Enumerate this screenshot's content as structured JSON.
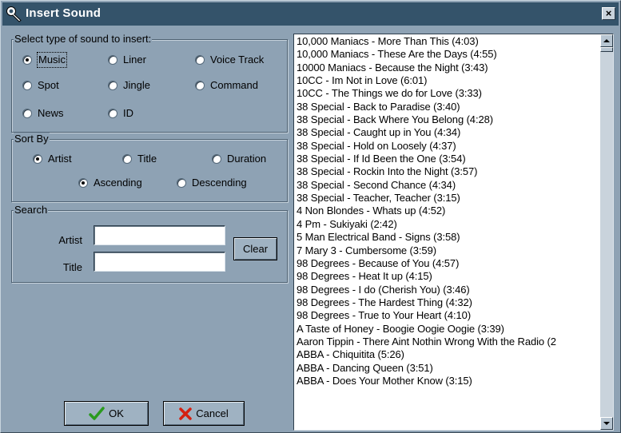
{
  "window": {
    "title": "Insert Sound",
    "close_glyph": "×"
  },
  "sound_type": {
    "label": "Select type of sound to insert:",
    "options": [
      "Music",
      "Liner",
      "Voice Track",
      "Spot",
      "Jingle",
      "Command",
      "News",
      "ID"
    ],
    "selected": "Music"
  },
  "sort": {
    "label": "Sort By",
    "fields": [
      "Artist",
      "Title",
      "Duration"
    ],
    "selected_field": "Artist",
    "orders": [
      "Ascending",
      "Descending"
    ],
    "selected_order": "Ascending"
  },
  "search": {
    "label": "Search",
    "artist_label": "Artist",
    "artist_value": "",
    "title_label": "Title",
    "title_value": "",
    "clear_label": "Clear"
  },
  "buttons": {
    "ok_label": "OK",
    "cancel_label": "Cancel"
  },
  "icons": {
    "ok": "check-icon",
    "cancel": "x-icon",
    "title": "wrench-icon"
  },
  "colors": {
    "titlebar": "#34536a",
    "background": "#8ea2b4",
    "ok_icon": "#2a9a1e",
    "cancel_icon": "#d42010"
  },
  "songs": [
    "10,000 Maniacs - More Than This (4:03)",
    "10,000 Maniacs - These Are the Days (4:55)",
    "10000 Maniacs - Because the Night (3:43)",
    "10CC - Im Not in Love (6:01)",
    "10CC - The Things we do for Love (3:33)",
    "38 Special - Back to Paradise (3:40)",
    "38 Special - Back Where You Belong (4:28)",
    "38 Special - Caught up in You (4:34)",
    "38 Special - Hold on Loosely (4:37)",
    "38 Special - If Id Been the One (3:54)",
    "38 Special - Rockin Into the Night (3:57)",
    "38 Special - Second Chance (4:34)",
    "38 Special - Teacher, Teacher (3:15)",
    "4 Non Blondes - Whats up (4:52)",
    "4 Pm - Sukiyaki (2:42)",
    "5 Man Electrical Band - Signs (3:58)",
    "7 Mary 3 - Cumbersome (3:59)",
    "98 Degrees - Because of You (4:57)",
    "98 Degrees - Heat It up (4:15)",
    "98 Degrees - I do (Cherish You) (3:46)",
    "98 Degrees - The Hardest Thing (4:32)",
    "98 Degrees - True to Your Heart (4:10)",
    "A Taste of Honey - Boogie Oogie Oogie (3:39)",
    "Aaron Tippin - There Aint Nothin Wrong With the Radio (2",
    "ABBA - Chiquitita (5:26)",
    "ABBA - Dancing Queen (3:51)",
    "ABBA - Does Your Mother Know (3:15)"
  ]
}
